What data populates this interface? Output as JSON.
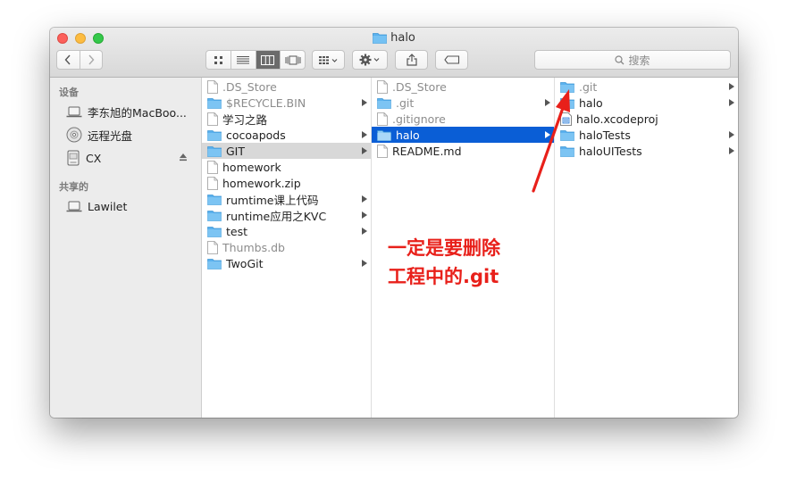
{
  "window": {
    "title": "halo"
  },
  "toolbar": {
    "search_placeholder": "搜索"
  },
  "sidebar": {
    "devices_header": "设备",
    "shared_header": "共享的",
    "devices": [
      {
        "label": "李东旭的MacBoo...",
        "icon": "laptop-icon"
      },
      {
        "label": "远程光盘",
        "icon": "disc-icon"
      },
      {
        "label": "CX",
        "icon": "drive-icon"
      }
    ],
    "shared": [
      {
        "label": "Lawilet",
        "icon": "laptop-icon"
      }
    ]
  },
  "columns": {
    "col1": [
      {
        "label": ".DS_Store",
        "kind": "file",
        "dim": true
      },
      {
        "label": "$RECYCLE.BIN",
        "kind": "folder",
        "dim": true,
        "chevron": true
      },
      {
        "label": "学习之路",
        "kind": "file"
      },
      {
        "label": "cocoapods",
        "kind": "folder",
        "chevron": true
      },
      {
        "label": "GIT",
        "kind": "folder",
        "chevron": true,
        "selected": "grey"
      },
      {
        "label": "homework",
        "kind": "file"
      },
      {
        "label": "homework.zip",
        "kind": "file"
      },
      {
        "label": "rumtime课上代码",
        "kind": "folder",
        "chevron": true
      },
      {
        "label": "runtime应用之KVC",
        "kind": "folder",
        "chevron": true
      },
      {
        "label": "test",
        "kind": "folder",
        "chevron": true
      },
      {
        "label": "Thumbs.db",
        "kind": "file",
        "dim": true
      },
      {
        "label": "TwoGit",
        "kind": "folder",
        "chevron": true
      }
    ],
    "col2": [
      {
        "label": ".DS_Store",
        "kind": "file",
        "dim": true
      },
      {
        "label": ".git",
        "kind": "folder",
        "dim": true,
        "chevron": true
      },
      {
        "label": ".gitignore",
        "kind": "file",
        "dim": true
      },
      {
        "label": "halo",
        "kind": "folder",
        "chevron": true,
        "selected": "blue"
      },
      {
        "label": "README.md",
        "kind": "file"
      }
    ],
    "col3": [
      {
        "label": ".git",
        "kind": "folder",
        "dim": true,
        "chevron": true
      },
      {
        "label": "halo",
        "kind": "folder",
        "chevron": true
      },
      {
        "label": "halo.xcodeproj",
        "kind": "project"
      },
      {
        "label": "haloTests",
        "kind": "folder",
        "chevron": true
      },
      {
        "label": "haloUITests",
        "kind": "folder",
        "chevron": true
      }
    ]
  },
  "annotation": {
    "line1": "一定是要删除",
    "line2": "工程中的.git",
    "color": "#e8201a"
  },
  "colors": {
    "selection_blue": "#0a5ed6",
    "folder_blue": "#5ab1ee"
  }
}
